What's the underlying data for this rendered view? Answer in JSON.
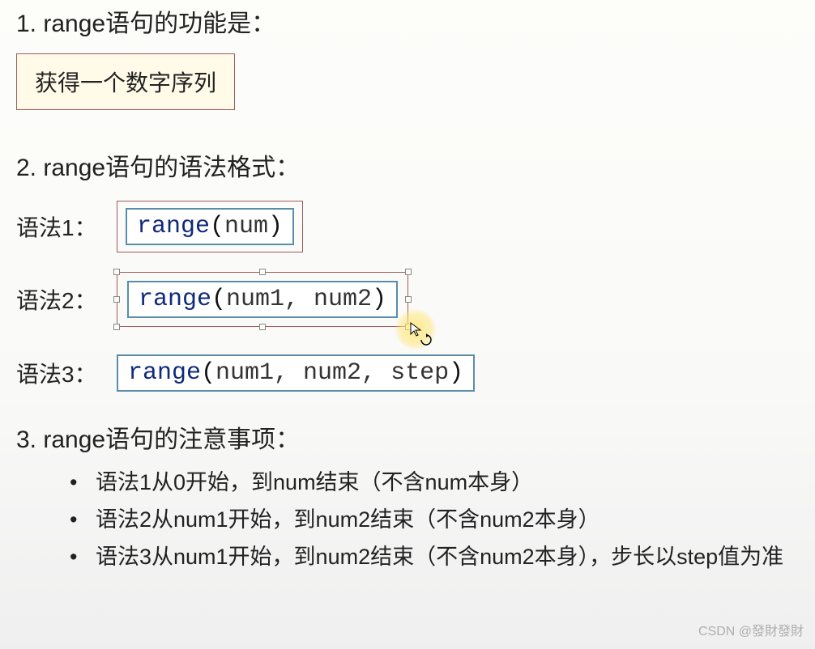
{
  "q1": {
    "title": "1. range语句的功能是：",
    "answer": "获得一个数字序列"
  },
  "q2": {
    "title": "2. range语句的语法格式：",
    "syntax1": {
      "label": "语法1：",
      "kw": "range",
      "paren_open": "(",
      "args": "num",
      "paren_close": ")"
    },
    "syntax2": {
      "label": "语法2：",
      "kw": "range",
      "paren_open": "(",
      "args": "num1, num2",
      "paren_close": ")"
    },
    "syntax3": {
      "label": "语法3：",
      "kw": "range",
      "paren_open": "(",
      "args": "num1, num2, step",
      "paren_close": ")"
    }
  },
  "q3": {
    "title": "3. range语句的注意事项：",
    "items": [
      "语法1从0开始，到num结束（不含num本身）",
      "语法2从num1开始，到num2结束（不含num2本身）",
      "语法3从num1开始，到num2结束（不含num2本身），步长以step值为准"
    ]
  },
  "watermark": "CSDN @發財發財"
}
